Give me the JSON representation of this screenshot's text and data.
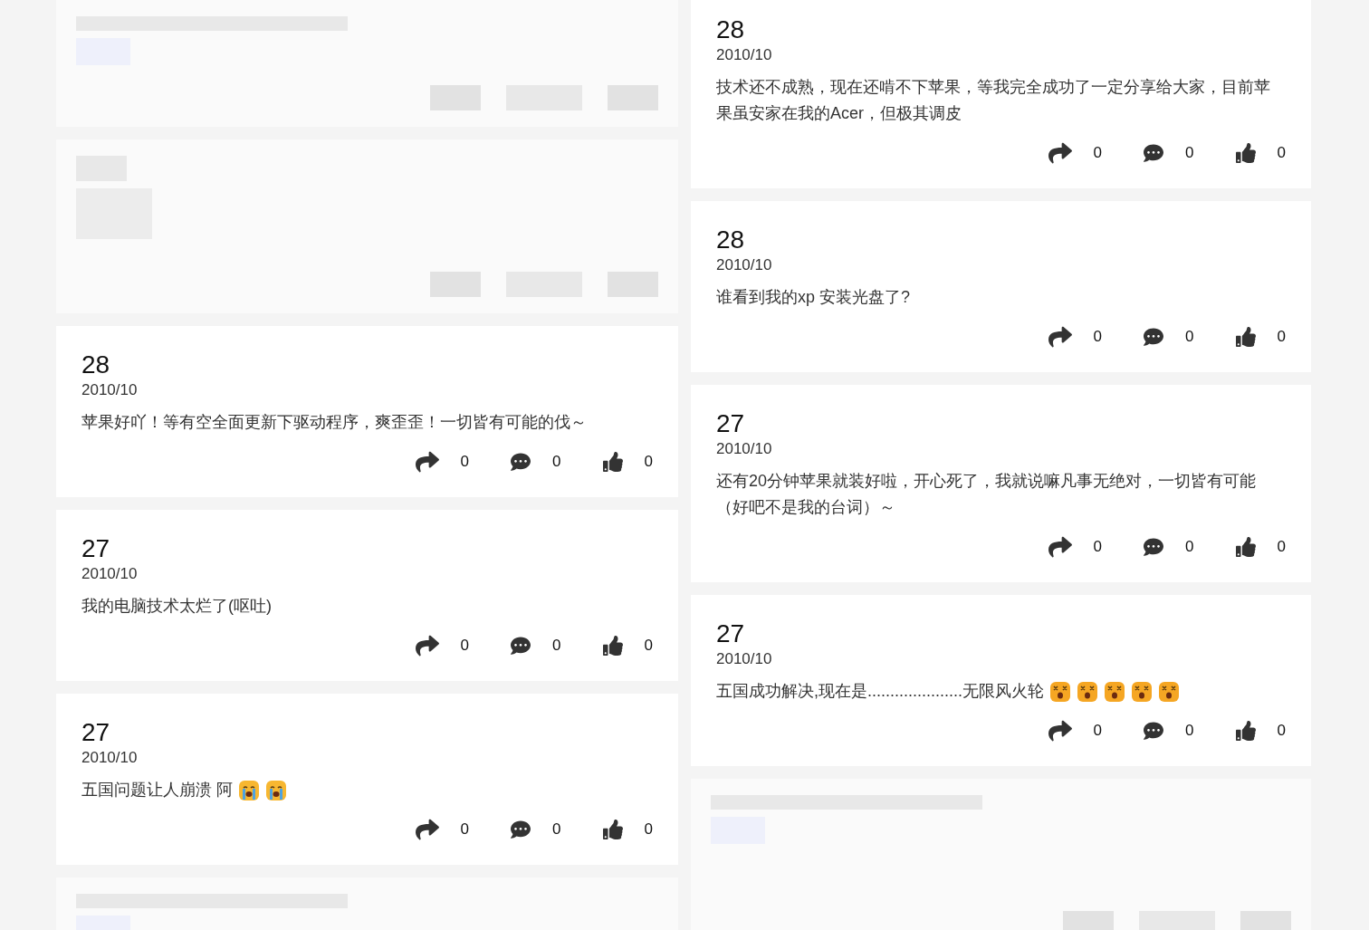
{
  "columns": [
    {
      "cards": [
        {
          "kind": "blurred"
        },
        {
          "kind": "blurred"
        },
        {
          "kind": "post",
          "day": "28",
          "month": "2010/10",
          "text": "苹果好吖！等有空全面更新下驱动程序，爽歪歪！一切皆有可能的伐～",
          "shares": "0",
          "comments": "0",
          "likes": "0"
        },
        {
          "kind": "post",
          "day": "27",
          "month": "2010/10",
          "text": "我的电脑技术太烂了(呕吐)",
          "shares": "0",
          "comments": "0",
          "likes": "0"
        },
        {
          "kind": "post",
          "day": "27",
          "month": "2010/10",
          "text": "五国问题让人崩溃 阿",
          "emojis": [
            {
              "kind": "crying"
            },
            {
              "kind": "crying"
            }
          ],
          "shares": "0",
          "comments": "0",
          "likes": "0"
        },
        {
          "kind": "blurred"
        }
      ]
    },
    {
      "cards": [
        {
          "kind": "post",
          "day": "28",
          "month": "2010/10",
          "text": "技术还不成熟，现在还啃不下苹果，等我完全成功了一定分享给大家，目前苹果虽安家在我的Acer，但极其调皮",
          "shares": "0",
          "comments": "0",
          "likes": "0"
        },
        {
          "kind": "post",
          "day": "28",
          "month": "2010/10",
          "text": "谁看到我的xp 安装光盘了?",
          "shares": "0",
          "comments": "0",
          "likes": "0"
        },
        {
          "kind": "post",
          "day": "27",
          "month": "2010/10",
          "text": "还有20分钟苹果就装好啦，开心死了，我就说嘛凡事无绝对，一切皆有可能（好吧不是我的台词）～",
          "shares": "0",
          "comments": "0",
          "likes": "0"
        },
        {
          "kind": "post",
          "day": "27",
          "month": "2010/10",
          "text": "五国成功解决,现在是.....................无限风火轮",
          "emojis": [
            {
              "kind": "dizzy"
            },
            {
              "kind": "dizzy"
            },
            {
              "kind": "dizzy"
            },
            {
              "kind": "dizzy"
            },
            {
              "kind": "dizzy"
            }
          ],
          "shares": "0",
          "comments": "0",
          "likes": "0"
        },
        {
          "kind": "blurred"
        }
      ]
    }
  ]
}
